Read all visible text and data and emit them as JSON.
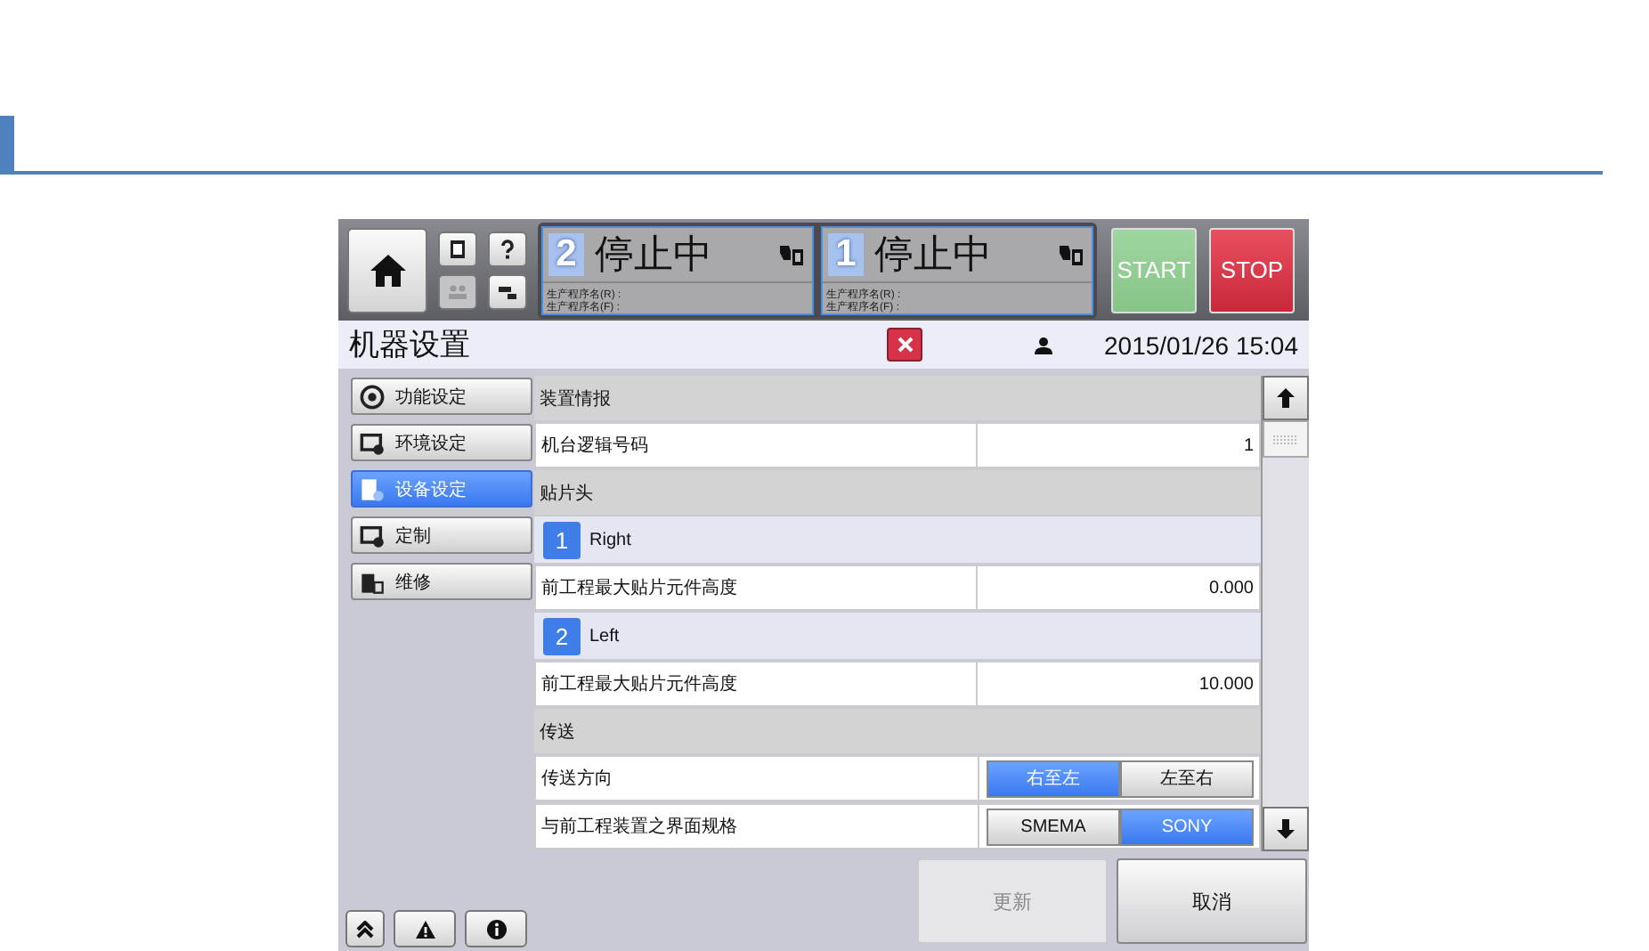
{
  "header": {
    "tool_buttons": [
      {
        "disabled": false
      },
      {
        "disabled": false
      },
      {
        "disabled": true
      },
      {
        "disabled": false
      }
    ],
    "heads": [
      {
        "number": "2",
        "status": "停止中",
        "program_r": "生产程序名(R) :",
        "program_f": "生产程序名(F) :"
      },
      {
        "number": "1",
        "status": "停止中",
        "program_r": "生产程序名(R) :",
        "program_f": "生产程序名(F) :"
      }
    ],
    "start": "START",
    "stop": "STOP"
  },
  "title_bar": {
    "title": "机器设置",
    "datetime": "2015/01/26 15:04"
  },
  "sidebar": {
    "items": [
      {
        "label": "功能设定",
        "selected": false
      },
      {
        "label": "环境设定",
        "selected": false
      },
      {
        "label": "设备设定",
        "selected": true
      },
      {
        "label": "定制",
        "selected": false
      },
      {
        "label": "维修",
        "selected": false
      }
    ]
  },
  "settings": [
    {
      "kind": "section",
      "label": "装置情报"
    },
    {
      "kind": "field",
      "label": "机台逻辑号码",
      "value": "1"
    },
    {
      "kind": "section",
      "label": "贴片头"
    },
    {
      "kind": "head",
      "number": "1",
      "label": "Right"
    },
    {
      "kind": "field",
      "label": "前工程最大贴片元件高度",
      "value": "0.000"
    },
    {
      "kind": "head",
      "number": "2",
      "label": "Left"
    },
    {
      "kind": "field",
      "label": "前工程最大贴片元件高度",
      "value": "10.000"
    },
    {
      "kind": "section",
      "label": "传送"
    },
    {
      "kind": "toggle",
      "label": "传送方向",
      "options": [
        {
          "label": "右至左",
          "selected": true
        },
        {
          "label": "左至右",
          "selected": false
        }
      ]
    },
    {
      "kind": "toggle",
      "label": "与前工程装置之界面规格",
      "options": [
        {
          "label": "SMEMA",
          "selected": false
        },
        {
          "label": "SONY",
          "selected": true
        }
      ]
    }
  ],
  "footer": {
    "buttons": [
      {
        "label": "更新",
        "disabled": true
      },
      {
        "label": "取消",
        "disabled": false
      }
    ]
  }
}
